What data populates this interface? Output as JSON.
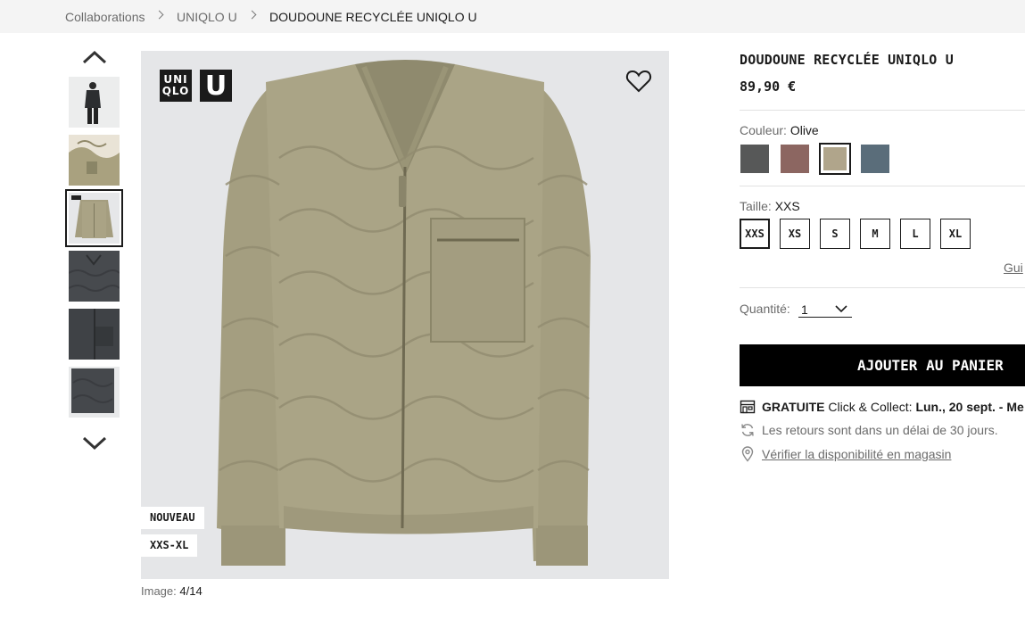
{
  "breadcrumb": {
    "items": [
      "Collaborations",
      "UNIQLO U",
      "DOUDOUNE RECYCLÉE UNIQLO U"
    ]
  },
  "gallery": {
    "badges": [
      "NOUVEAU",
      "XXS-XL"
    ],
    "logo_left": "UNI\nQLO",
    "logo_right": "U",
    "counter_label": "Image:",
    "counter_value": "4/14"
  },
  "product": {
    "title": "DOUDOUNE RECYCLÉE UNIQLO U",
    "price": "89,90 €"
  },
  "color": {
    "label": "Couleur:",
    "selected": "Olive",
    "swatches": [
      {
        "name": "dark-gray",
        "hex": "#575858"
      },
      {
        "name": "brown",
        "hex": "#8c6661"
      },
      {
        "name": "olive",
        "hex": "#b0a58b",
        "selected": true
      },
      {
        "name": "blue",
        "hex": "#5a6d7a"
      }
    ]
  },
  "size": {
    "label": "Taille:",
    "selected": "XXS",
    "options": [
      "XXS",
      "XS",
      "S",
      "M",
      "L",
      "XL"
    ],
    "guide_link": "Gui"
  },
  "quantity": {
    "label": "Quantité:",
    "value": "1"
  },
  "cart": {
    "button_label": "AJOUTER AU PANIER"
  },
  "shipping": {
    "free_label": "GRATUITE",
    "click_collect": "Click & Collect:",
    "date": "Lun., 20 sept. - Me",
    "returns": "Les retours sont dans un délai de 30 jours.",
    "availability_link": "Vérifier la disponibilité en magasin"
  }
}
